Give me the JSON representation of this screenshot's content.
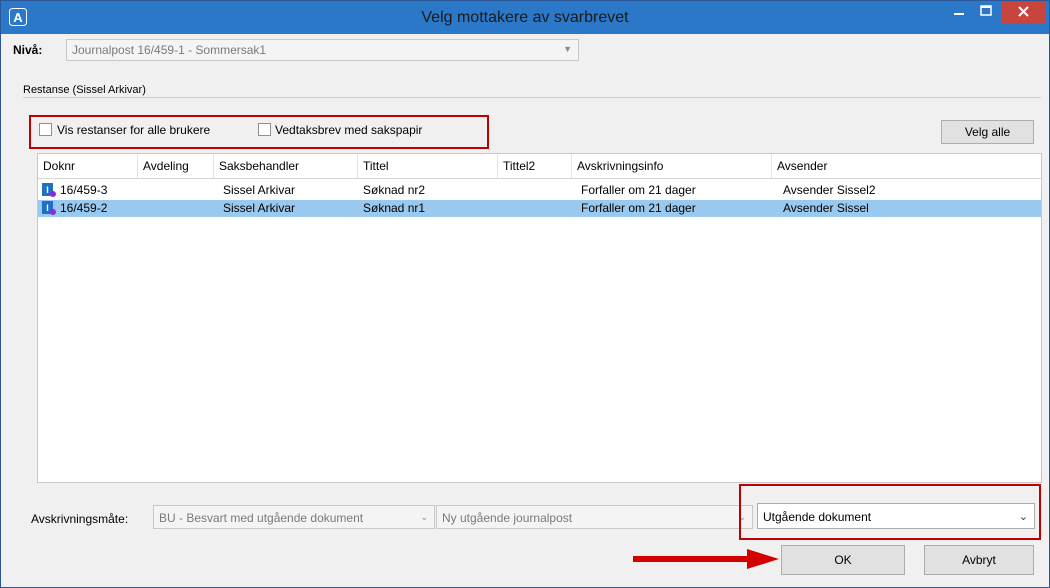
{
  "window": {
    "title": "Velg mottakere av svarbrevet",
    "app_icon_letter": "A",
    "titlebar_color": "#2b77c8",
    "close_color": "#c7443f"
  },
  "level": {
    "label": "Nivå:",
    "value": "Journalpost 16/459-1 - Sommersak1"
  },
  "restanse": {
    "group_label": "Restanse (Sissel Arkivar)",
    "checkbox_all_users": "Vis restanser for alle brukere",
    "checkbox_vedtak": "Vedtaksbrev med sakspapir",
    "select_all_button": "Velg alle"
  },
  "grid": {
    "columns": [
      "Doknr",
      "Avdeling",
      "Saksbehandler",
      "Tittel",
      "Tittel2",
      "Avskrivningsinfo",
      "Avsender"
    ],
    "rows": [
      {
        "doknr": "16/459-3",
        "avdeling": "",
        "saksbehandler": "Sissel Arkivar",
        "tittel": "Søknad nr2",
        "tittel2": "",
        "avskrivningsinfo": "Forfaller om 21 dager",
        "avsender": "Avsender Sissel2",
        "selected": false
      },
      {
        "doknr": "16/459-2",
        "avdeling": "",
        "saksbehandler": "Sissel Arkivar",
        "tittel": "Søknad nr1",
        "tittel2": "",
        "avskrivningsinfo": "Forfaller om 21 dager",
        "avsender": "Avsender Sissel",
        "selected": true
      }
    ],
    "selected_color": "#99c9ef"
  },
  "footer": {
    "avskrivningsmate_label": "Avskrivningsmåte:",
    "avskrivningsmate_value": "BU - Besvart med utgående dokument",
    "journalpost_value": "Ny utgående journalpost",
    "dokument_value": "Utgående dokument",
    "ok_label": "OK",
    "cancel_label": "Avbryt"
  },
  "annotations": {
    "highlight_color": "#c00000"
  }
}
